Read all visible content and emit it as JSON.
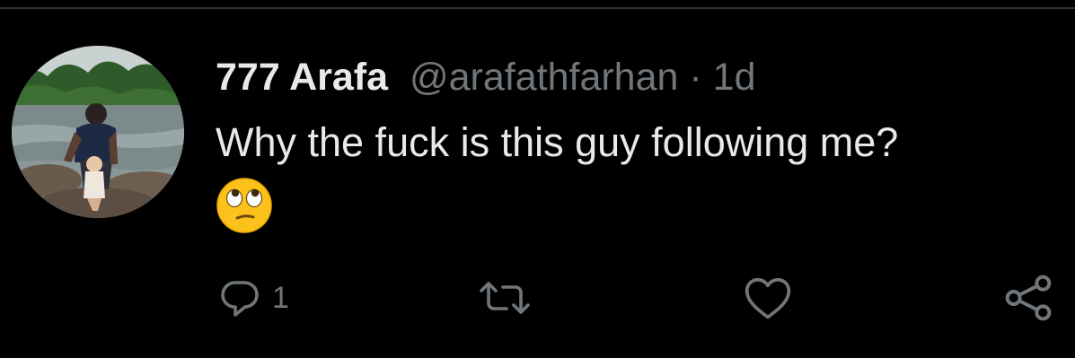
{
  "tweet": {
    "author": {
      "display_name": "777 Arafa",
      "handle": "@arafathfarhan"
    },
    "separator": "·",
    "time_ago": "1d",
    "text": "Why the fuck is this guy following me?",
    "emoji": "face-with-rolling-eyes"
  },
  "actions": {
    "reply_count": "1"
  },
  "colors": {
    "background": "#000000",
    "primary_text": "#e7e9ea",
    "secondary_text": "#71767b",
    "divider": "#2f3336"
  }
}
